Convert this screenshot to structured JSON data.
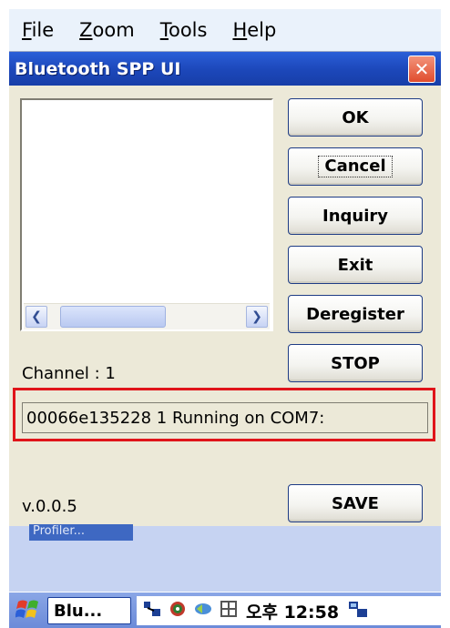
{
  "menu": {
    "items": [
      "File",
      "Zoom",
      "Tools",
      "Help"
    ]
  },
  "window": {
    "title": "Bluetooth SPP UI",
    "close_glyph": "✕"
  },
  "buttons": {
    "ok": "OK",
    "cancel": "Cancel",
    "inquiry": "Inquiry",
    "exit": "Exit",
    "deregister": "Deregister",
    "stop": "STOP",
    "save": "SAVE"
  },
  "scroll": {
    "left_glyph": "❮",
    "right_glyph": "❯"
  },
  "channel_label": "Channel : 1",
  "status_text": "00066e135228 1 Running on COM7:",
  "version": "v.0.0.5",
  "underlying_label": "Profiler...",
  "taskbar": {
    "task_button_label": "Blu...",
    "clock": "오후 12:58",
    "icons": [
      "start-icon",
      "network-icon",
      "bluetooth-icon",
      "sync-icon",
      "keyboard-icon",
      "desktop-icon"
    ]
  },
  "colors": {
    "titlebar": "#1c47b9",
    "highlight": "#e0141a",
    "window_bg": "#ece9d8"
  }
}
